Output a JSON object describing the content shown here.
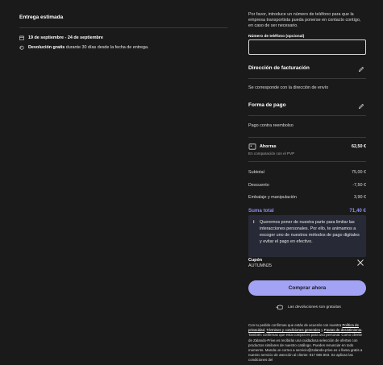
{
  "delivery": {
    "title": "Entrega estimada",
    "date_range": "19 de septiembre - 24 de septiembre",
    "returns_bold": "Devolución gratis",
    "returns_text": " durante 30 días desde la fecha de entrega."
  },
  "phone": {
    "help_text": "Por favor, introduce un número de teléfono para que la empresa transportista pueda ponerse en contacto contigo, en caso de ser necesario.",
    "label": "Número de teléfono (opcional)",
    "value": "",
    "placeholder": ""
  },
  "billing": {
    "title": "Dirección de facturación",
    "text": "Se corresponde con la dirección de envío"
  },
  "payment": {
    "title": "Forma de pago",
    "text": "Pago contra reembolso"
  },
  "savings": {
    "label": "Ahorras",
    "sub": "En comparación con el PVP",
    "value": "62,50 €"
  },
  "summary": {
    "subtotal_label": "Subtotal",
    "subtotal_value": "75,00 €",
    "discount_label": "Descuento",
    "discount_value": "-7,50 €",
    "shipping_label": "Embalaje y manipulación",
    "shipping_value": "3,90 €",
    "total_label": "Suma total",
    "total_value": "71,40 €"
  },
  "info": {
    "icon": "i",
    "text": "Queremos poner de nuestra parte para limitar las interacciones personales. Por ello, te animamos a escoger uno de nuestros métodos de pago digitales y evitar el pago en efectivo."
  },
  "coupon": {
    "label": "Cupón",
    "code": "AUTUMN25"
  },
  "buy_button": "Comprar ahora",
  "free_returns": "Las devoluciones son gratuitas",
  "legal": {
    "p1": "Con tu pedido confirmas que estás de acuerdo con nuestra ",
    "link1": "Política de privacidad",
    "p2": ", ",
    "link2": "Términos y condiciones generales",
    "p3": " y ",
    "link3": "Pautas de desistimiento",
    "p4": ". También confirmas que esta compra es para uso personal. Como cliente de Zalando-Prive.es recibirás una cuidadosa selección de ofertas con productos similares de nuestro catálogo. Puedes renunciar en todo momento. Manda un correo a servicio@zalando-prive.es o llama gratis a nuestro servicio de atención al cliente: 917 696 803. Se aplican las condiciones del"
  },
  "colors": {
    "background": "#1a1a1a",
    "accent": "#a3a3f5",
    "total": "#8c8cf0",
    "info_bg": "#272a36"
  }
}
